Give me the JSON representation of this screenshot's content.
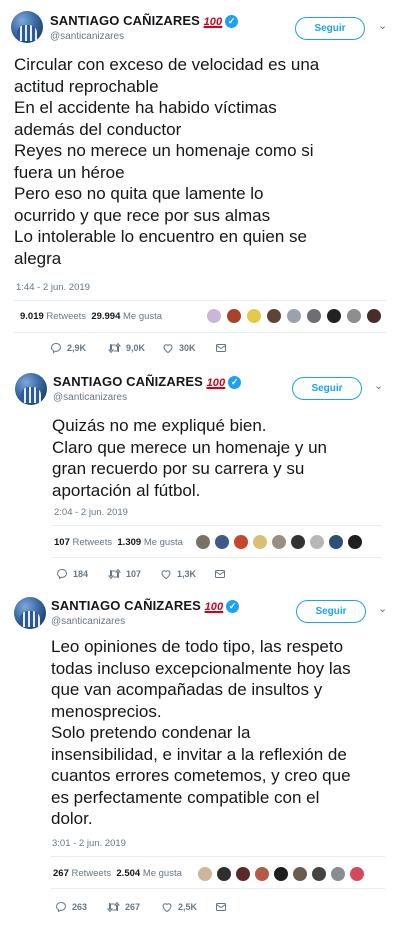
{
  "tweets": [
    {
      "author": "SANTIAGO CAÑIZARES",
      "emoji": "100",
      "verified_icon": "✓",
      "handle": "@santicanizares",
      "follow_label": "Seguir",
      "caret": "⌄",
      "lines": [
        "Circular con exceso de velocidad es una",
        "actitud reprochable",
        "En el accidente ha habido víctimas",
        "además del conductor",
        "Reyes no merece un homenaje como si",
        "fuera un héroe",
        "Pero eso no quita que lamente lo",
        "ocurrido y que rece por sus almas",
        "Lo intolerable lo encuentro en quien se",
        "alegra"
      ],
      "timestamp": "1:44 - 2 jun. 2019",
      "retweets_count": "9.019",
      "retweets_label": "Retweets",
      "likes_count": "29.994",
      "likes_label": "Me gusta",
      "reply_count": "2,9K",
      "retweet_count": "9,0K",
      "like_count": "30K"
    },
    {
      "author": "SANTIAGO CAÑIZARES",
      "emoji": "100",
      "verified_icon": "✓",
      "handle": "@santicanizares",
      "follow_label": "Seguir",
      "caret": "⌄",
      "lines": [
        "Quizás no me expliqué bien.",
        "Claro que merece un homenaje y un",
        "gran recuerdo por su carrera y su",
        "aportación al fútbol."
      ],
      "timestamp": "2:04 - 2 jun. 2019",
      "retweets_count": "107",
      "retweets_label": "Retweets",
      "likes_count": "1.309",
      "likes_label": "Me gusta",
      "reply_count": "184",
      "retweet_count": "107",
      "like_count": "1,3K"
    },
    {
      "author": "SANTIAGO CAÑIZARES",
      "emoji": "100",
      "verified_icon": "✓",
      "handle": "@santicanizares",
      "follow_label": "Seguir",
      "caret": "⌄",
      "lines": [
        "Leo opiniones de todo tipo, las respeto",
        "todas incluso excepcionalmente hoy las",
        "que van acompañadas de insultos y",
        "menosprecios.",
        "Solo pretendo condenar la",
        "insensibilidad, e invitar a la reflexión de",
        "cuantos errores cometemos, y creo que",
        "es perfectamente compatible con el",
        "dolor."
      ],
      "timestamp": "3:01 - 2 jun. 2019",
      "retweets_count": "267",
      "retweets_label": "Retweets",
      "likes_count": "2.504",
      "likes_label": "Me gusta",
      "reply_count": "263",
      "retweet_count": "267",
      "like_count": "2,5K"
    }
  ],
  "colors": {
    "accent": "#1da1f2",
    "text": "#14171a",
    "secondary": "#657786",
    "emoji_red": "#d0021b",
    "divider": "#e6ecf0"
  },
  "icons": {
    "reply": "reply-icon",
    "retweet": "retweet-icon",
    "like": "heart-icon",
    "dm": "envelope-icon",
    "verified": "verified-badge-icon",
    "more": "chevron-down-icon"
  }
}
